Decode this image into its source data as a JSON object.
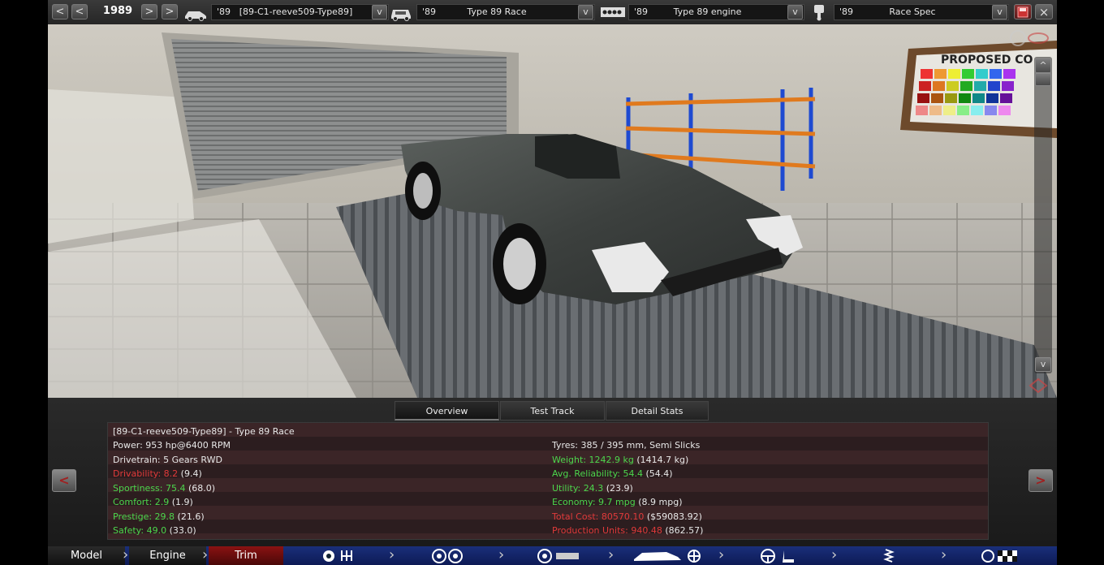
{
  "topbar": {
    "year": "1989",
    "model": {
      "year": "'89",
      "name": "[89-C1-reeve509-Type89]"
    },
    "trim": {
      "year": "'89",
      "name": "Type 89 Race"
    },
    "engine": {
      "year": "'89",
      "name": "Type 89 engine"
    },
    "variant": {
      "year": "'89",
      "name": "Race Spec"
    },
    "buttons": {
      "prev2": "<",
      "prev": "<",
      "next": ">",
      "next2": ">",
      "dropdown": "v",
      "close": "×"
    }
  },
  "viewport": {
    "sign_text": "PROPOSED CO",
    "scroll_up": "^",
    "scroll_down": "v"
  },
  "panel": {
    "tabs": [
      "Overview",
      "Test Track",
      "Detail Stats"
    ],
    "active_tab": "Overview",
    "nav_left": "<",
    "nav_right": ">",
    "car_title": "[89-C1-reeve509-Type89] - Type 89 Race",
    "left_stats": [
      {
        "label": "Power: 953 hp@6400 RPM",
        "extra": "",
        "color": "white"
      },
      {
        "label": "Drivetrain: 5 Gears RWD",
        "extra": "",
        "color": "white"
      },
      {
        "label": "Drivability: 8.2",
        "extra": " (9.4)",
        "color": "red"
      },
      {
        "label": "Sportiness: 75.4",
        "extra": " (68.0)",
        "color": "green"
      },
      {
        "label": "Comfort: 2.9",
        "extra": " (1.9)",
        "color": "green"
      },
      {
        "label": "Prestige: 29.8",
        "extra": " (21.6)",
        "color": "green"
      },
      {
        "label": "Safety: 49.0",
        "extra": " (33.0)",
        "color": "green"
      }
    ],
    "right_stats": [
      {
        "label": "Tyres: 385 / 395 mm, Semi Slicks",
        "extra": "",
        "color": "white"
      },
      {
        "label": "Weight: 1242.9 kg",
        "extra": " (1414.7 kg)",
        "color": "green"
      },
      {
        "label": "Avg. Reliability: 54.4",
        "extra": " (54.4)",
        "color": "green"
      },
      {
        "label": "Utility: 24.3",
        "extra": " (23.9)",
        "color": "green"
      },
      {
        "label": "Economy: 9.7 mpg",
        "extra": " (8.9 mpg)",
        "color": "green"
      },
      {
        "label": "Total Cost: 80570.10",
        "extra": " ($59083.92)",
        "color": "red"
      },
      {
        "label": "Production Units: 940.48",
        "extra": " (862.57)",
        "color": "red"
      }
    ]
  },
  "bottomnav": {
    "items": [
      "Model",
      "Engine",
      "Trim"
    ],
    "active": "Trim",
    "icons": [
      "gearbox-icon",
      "wheels-icon",
      "brakes-icon",
      "body-aero-icon",
      "interior-icon",
      "suspension-icon",
      "test-icon"
    ]
  },
  "colors": {
    "accent_red": "#e03a3a",
    "accent_green": "#4cd64c",
    "nav_blue": "#1a2f7a"
  }
}
